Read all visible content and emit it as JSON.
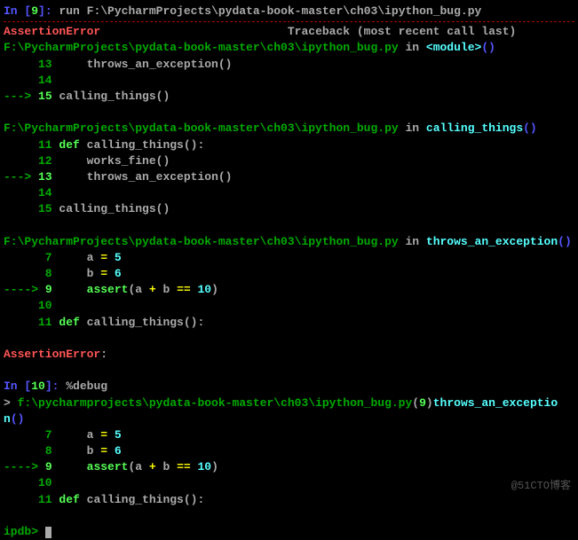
{
  "input1": {
    "prefix": "In [",
    "num": "9",
    "suffix": "]: ",
    "cmd": "run F:\\PycharmProjects\\pydata-book-master\\ch03\\ipython_bug.py"
  },
  "traceback_header": {
    "err": "AssertionError",
    "tb": "Traceback (most recent call last)"
  },
  "frame1": {
    "path": "F:\\PycharmProjects\\pydata-book-master\\ch03\\ipython_bug.py",
    "in": " in ",
    "func": "<module>",
    "paren": "()",
    "lines": [
      {
        "num": "     13",
        "arrow": "",
        "code": "    throws_an_exception()"
      },
      {
        "num": "     14",
        "arrow": "",
        "code": ""
      },
      {
        "num": "     15",
        "arrow": "---> ",
        "code": "calling_things()"
      }
    ]
  },
  "frame2": {
    "path": "F:\\PycharmProjects\\pydata-book-master\\ch03\\ipython_bug.py",
    "in": " in ",
    "func": "calling_things",
    "paren": "()",
    "lines": [
      {
        "num": "     11",
        "arrow": "",
        "code_k": "def ",
        "code": "calling_things():"
      },
      {
        "num": "     12",
        "arrow": "",
        "code": "    works_fine()"
      },
      {
        "num": "     13",
        "arrow": "---> ",
        "code": "    throws_an_exception()"
      },
      {
        "num": "     14",
        "arrow": "",
        "code": ""
      },
      {
        "num": "     15",
        "arrow": "",
        "code": "calling_things()"
      }
    ]
  },
  "frame3": {
    "path": "F:\\PycharmProjects\\pydata-book-master\\ch03\\ipython_bug.py",
    "in": " in ",
    "func": "throws_an_exception",
    "paren": "()",
    "lines": [
      {
        "num": "      7",
        "arrow": "",
        "code_pre": "    a ",
        "eq": "=",
        "val": " 5"
      },
      {
        "num": "      8",
        "arrow": "",
        "code_pre": "    b ",
        "eq": "=",
        "val": " 6"
      },
      {
        "num": "      9",
        "arrow": "----> ",
        "code_pre": "    ",
        "kw": "assert",
        "mid": "(a ",
        "op": "+",
        "mid2": " b ",
        "eq": "==",
        "val": " 10",
        "end": ")"
      },
      {
        "num": "     10",
        "arrow": "",
        "code": ""
      },
      {
        "num": "     11",
        "arrow": "",
        "code_k": "def ",
        "code": "calling_things():"
      }
    ]
  },
  "final_err": {
    "name": "AssertionError",
    "colon": ":"
  },
  "input2": {
    "prefix": "In [",
    "num": "10",
    "suffix": "]: ",
    "cmd": "%debug"
  },
  "dbg_header": {
    "g": ">",
    "path": " f:\\pycharmprojects\\pydata-book-master\\ch03\\ipython_bug.py",
    "p1": "(",
    "ln": "9",
    "p2": ")",
    "func": "throws_an_exceptio",
    "func2": "n",
    "paren": "()"
  },
  "dbg_lines": [
    {
      "num": "      7",
      "arrow": "",
      "code_pre": "    a ",
      "eq": "=",
      "val": " 5"
    },
    {
      "num": "      8",
      "arrow": "",
      "code_pre": "    b ",
      "eq": "=",
      "val": " 6"
    },
    {
      "num": "      9",
      "arrow": "----> ",
      "code_pre": "    ",
      "kw": "assert",
      "mid": "(a ",
      "op": "+",
      "mid2": " b ",
      "eq": "==",
      "val": " 10",
      "end": ")"
    },
    {
      "num": "     10",
      "arrow": "",
      "code": ""
    },
    {
      "num": "     11",
      "arrow": "",
      "code_k": "def ",
      "code": "calling_things():"
    }
  ],
  "ipdb": "ipdb> ",
  "watermark": "@51CTO博客"
}
